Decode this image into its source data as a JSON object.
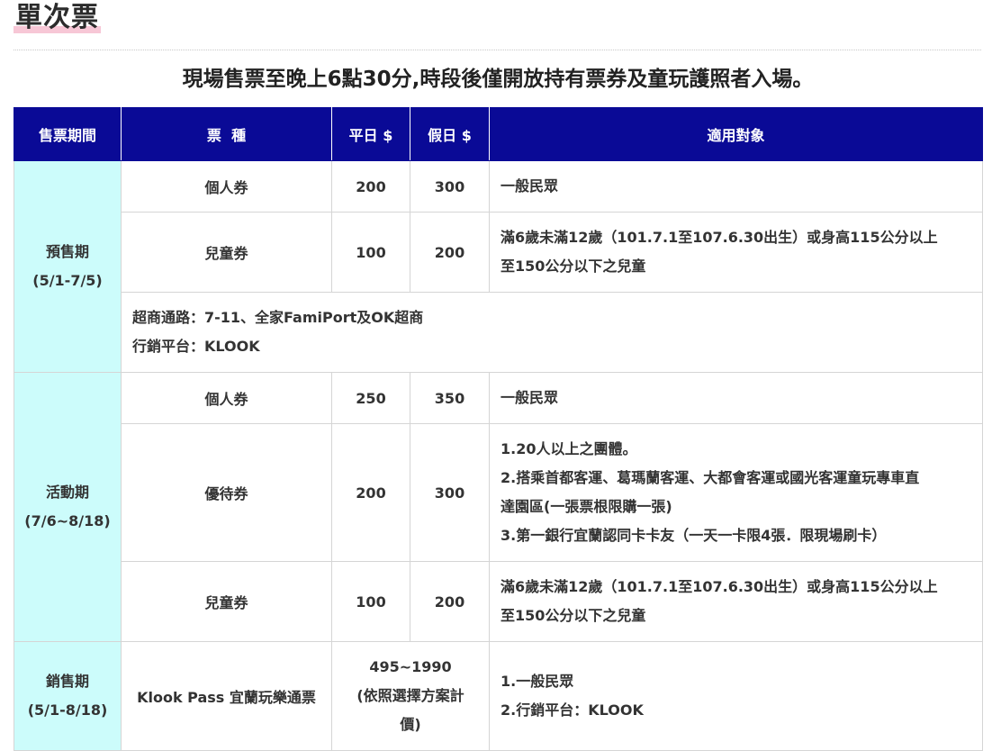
{
  "section_title": "單次票",
  "notice": "現場售票至晚上6點30分,時段後僅開放持有票券及童玩護照者入場。",
  "table": {
    "headers": [
      "售票期間",
      "票  種",
      "平日 $",
      "假日 $",
      "適用對象"
    ],
    "presale": {
      "period_name": "預售期",
      "period_dates": "(5/1-7/5)",
      "rows": [
        {
          "type": "個人券",
          "weekday": "200",
          "holiday": "300",
          "target": [
            "一般民眾"
          ]
        },
        {
          "type": "兒童券",
          "weekday": "100",
          "holiday": "200",
          "target": [
            "滿6歲未滿12歲（101.7.1至107.6.30出生）或身高115公分以上",
            "至150公分以下之兒童"
          ]
        }
      ],
      "notes": [
        "超商通路：7-11、全家FamiPort及OK超商",
        "行銷平台：KLOOK"
      ]
    },
    "event": {
      "period_name": "活動期",
      "period_dates": "(7/6~8/18)",
      "rows": [
        {
          "type": "個人券",
          "weekday": "250",
          "holiday": "350",
          "target": [
            "一般民眾"
          ]
        },
        {
          "type": "優待券",
          "weekday": "200",
          "holiday": "300",
          "target": [
            "1.20人以上之團體。",
            "2.搭乘首都客運、葛瑪蘭客運、大都會客運或國光客運童玩專車直",
            "達園區(一張票根限購一張)",
            "3.第一銀行宜蘭認同卡卡友（一天一卡限4張．限現場刷卡）"
          ]
        },
        {
          "type": "兒童券",
          "weekday": "100",
          "holiday": "200",
          "target": [
            "滿6歲未滿12歲（101.7.1至107.6.30出生）或身高115公分以上",
            "至150公分以下之兒童"
          ]
        }
      ]
    },
    "sale": {
      "period_name": "銷售期",
      "period_dates": "(5/1-8/18)",
      "type": "Klook Pass 宜蘭玩樂通票",
      "price": [
        "495~1990",
        "(依照選擇方案計",
        "價)"
      ],
      "target": [
        "1.一般民眾",
        "2.行銷平台：KLOOK"
      ]
    }
  }
}
